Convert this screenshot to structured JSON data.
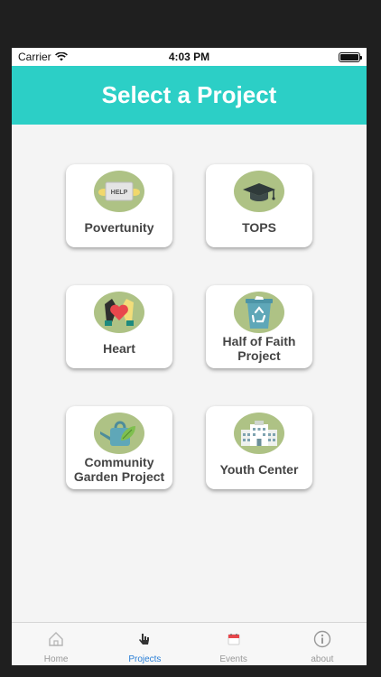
{
  "status_bar": {
    "carrier": "Carrier",
    "time": "4:03 PM",
    "battery_level": 1.0
  },
  "header": {
    "title": "Select a Project"
  },
  "projects": [
    {
      "label_lines": [
        "Povertunity"
      ],
      "icon": "help-sign-icon",
      "icon_text": "HELP"
    },
    {
      "label_lines": [
        "TOPS"
      ],
      "icon": "graduation-cap-icon"
    },
    {
      "label_lines": [
        "Heart"
      ],
      "icon": "hands-heart-icon"
    },
    {
      "label_lines": [
        "Half of Faith",
        "Project"
      ],
      "icon": "recycle-bin-icon"
    },
    {
      "label_lines": [
        "Community",
        "Garden Project"
      ],
      "icon": "watering-can-icon"
    },
    {
      "label_lines": [
        "Youth Center"
      ],
      "icon": "building-icon"
    }
  ],
  "tabs": [
    {
      "label": "Home",
      "icon": "home-icon",
      "active": false
    },
    {
      "label": "Projects",
      "icon": "projects-icon",
      "active": true
    },
    {
      "label": "Events",
      "icon": "calendar-icon",
      "active": false
    },
    {
      "label": "about",
      "icon": "info-icon",
      "active": false
    }
  ],
  "colors": {
    "header": "#2ccfc6",
    "icon_circle": "#aec285",
    "active_tab": "#2b7fd6",
    "inactive_tab": "#999999"
  }
}
